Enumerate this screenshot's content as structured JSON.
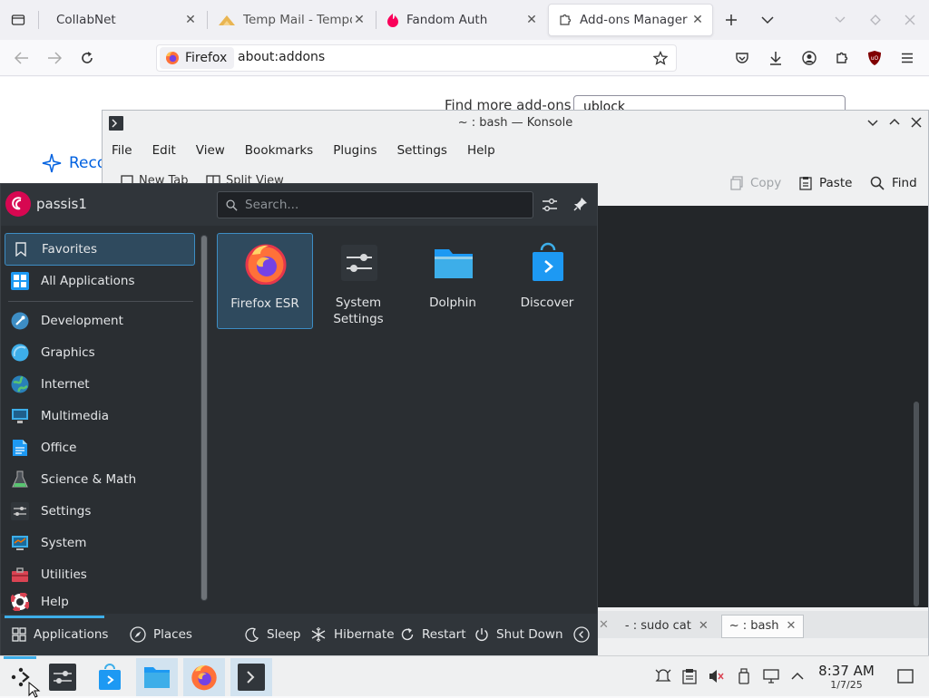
{
  "firefox": {
    "tabs": [
      {
        "title": "CollabNet",
        "icon": "none"
      },
      {
        "title": "Temp Mail - Tempor",
        "icon": "tempmail-icon"
      },
      {
        "title": "Fandom Auth",
        "icon": "fandom-icon"
      },
      {
        "title": "Add-ons Manager",
        "icon": "puzzle-icon",
        "active": true
      }
    ],
    "identity_label": "Firefox",
    "url": "about:addons",
    "page": {
      "find_more_label": "Find more add-ons",
      "search_value": "ublock",
      "recommendations_label": "Recommendations"
    }
  },
  "konsole": {
    "title": "~ : bash — Konsole",
    "menu": [
      "File",
      "Edit",
      "View",
      "Bookmarks",
      "Plugins",
      "Settings",
      "Help"
    ],
    "toolbar": {
      "new_tab": "New Tab",
      "split_view": "Split View",
      "copy": "Copy",
      "paste": "Paste",
      "find": "Find"
    },
    "tabs": [
      {
        "title": "- : sudo cat"
      },
      {
        "title": "~ : bash",
        "active": true
      }
    ]
  },
  "kickoff": {
    "username": "passis1",
    "search_placeholder": "Search...",
    "categories": [
      {
        "label": "Favorites",
        "icon": "bookmark-icon",
        "selected": true
      },
      {
        "label": "All Applications",
        "icon": "grid-icon"
      },
      {
        "label": "Development",
        "icon": "development-icon"
      },
      {
        "label": "Graphics",
        "icon": "graphics-icon"
      },
      {
        "label": "Internet",
        "icon": "globe-icon"
      },
      {
        "label": "Multimedia",
        "icon": "multimedia-icon"
      },
      {
        "label": "Office",
        "icon": "office-icon"
      },
      {
        "label": "Science & Math",
        "icon": "flask-icon"
      },
      {
        "label": "Settings",
        "icon": "settings-icon"
      },
      {
        "label": "System",
        "icon": "system-icon"
      },
      {
        "label": "Utilities",
        "icon": "toolbox-icon"
      },
      {
        "label": "Help",
        "icon": "lifebuoy-icon"
      }
    ],
    "favorites": [
      {
        "label": "Firefox ESR",
        "icon": "firefox-icon",
        "selected": true
      },
      {
        "label": "System Settings",
        "icon": "system-settings-icon"
      },
      {
        "label": "Dolphin",
        "icon": "folder-icon"
      },
      {
        "label": "Discover",
        "icon": "discover-icon"
      }
    ],
    "footer": {
      "applications": "Applications",
      "places": "Places",
      "sleep": "Sleep",
      "hibernate": "Hibernate",
      "restart": "Restart",
      "shutdown": "Shut Down"
    }
  },
  "taskbar": {
    "clock_time": "8:37 AM",
    "clock_date": "1/7/25"
  },
  "colors": {
    "kickoff_bg": "#2a2e32",
    "selection": "#3d8dc4",
    "terminal_bg": "#232629"
  }
}
